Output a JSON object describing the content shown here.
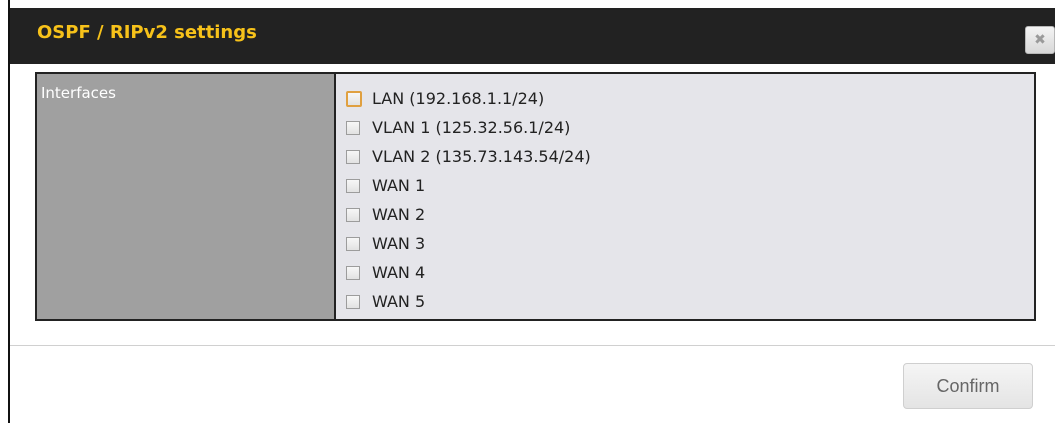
{
  "dialog": {
    "title": "OSPF / RIPv2 settings",
    "close_glyph": "✖",
    "close_icon": "close-icon",
    "title_color": "#f7c21a",
    "titlebar_color": "#222222"
  },
  "settings": {
    "interfaces_label": "Interfaces",
    "interfaces": [
      {
        "label": "LAN (192.168.1.1/24)",
        "checked": false,
        "focused": true
      },
      {
        "label": "VLAN 1 (125.32.56.1/24)",
        "checked": false,
        "focused": false
      },
      {
        "label": "VLAN 2 (135.73.143.54/24)",
        "checked": false,
        "focused": false
      },
      {
        "label": "WAN 1",
        "checked": false,
        "focused": false
      },
      {
        "label": "WAN 2",
        "checked": false,
        "focused": false
      },
      {
        "label": "WAN 3",
        "checked": false,
        "focused": false
      },
      {
        "label": "WAN 4",
        "checked": false,
        "focused": false
      },
      {
        "label": "WAN 5",
        "checked": false,
        "focused": false
      }
    ]
  },
  "footer": {
    "confirm_label": "Confirm"
  }
}
